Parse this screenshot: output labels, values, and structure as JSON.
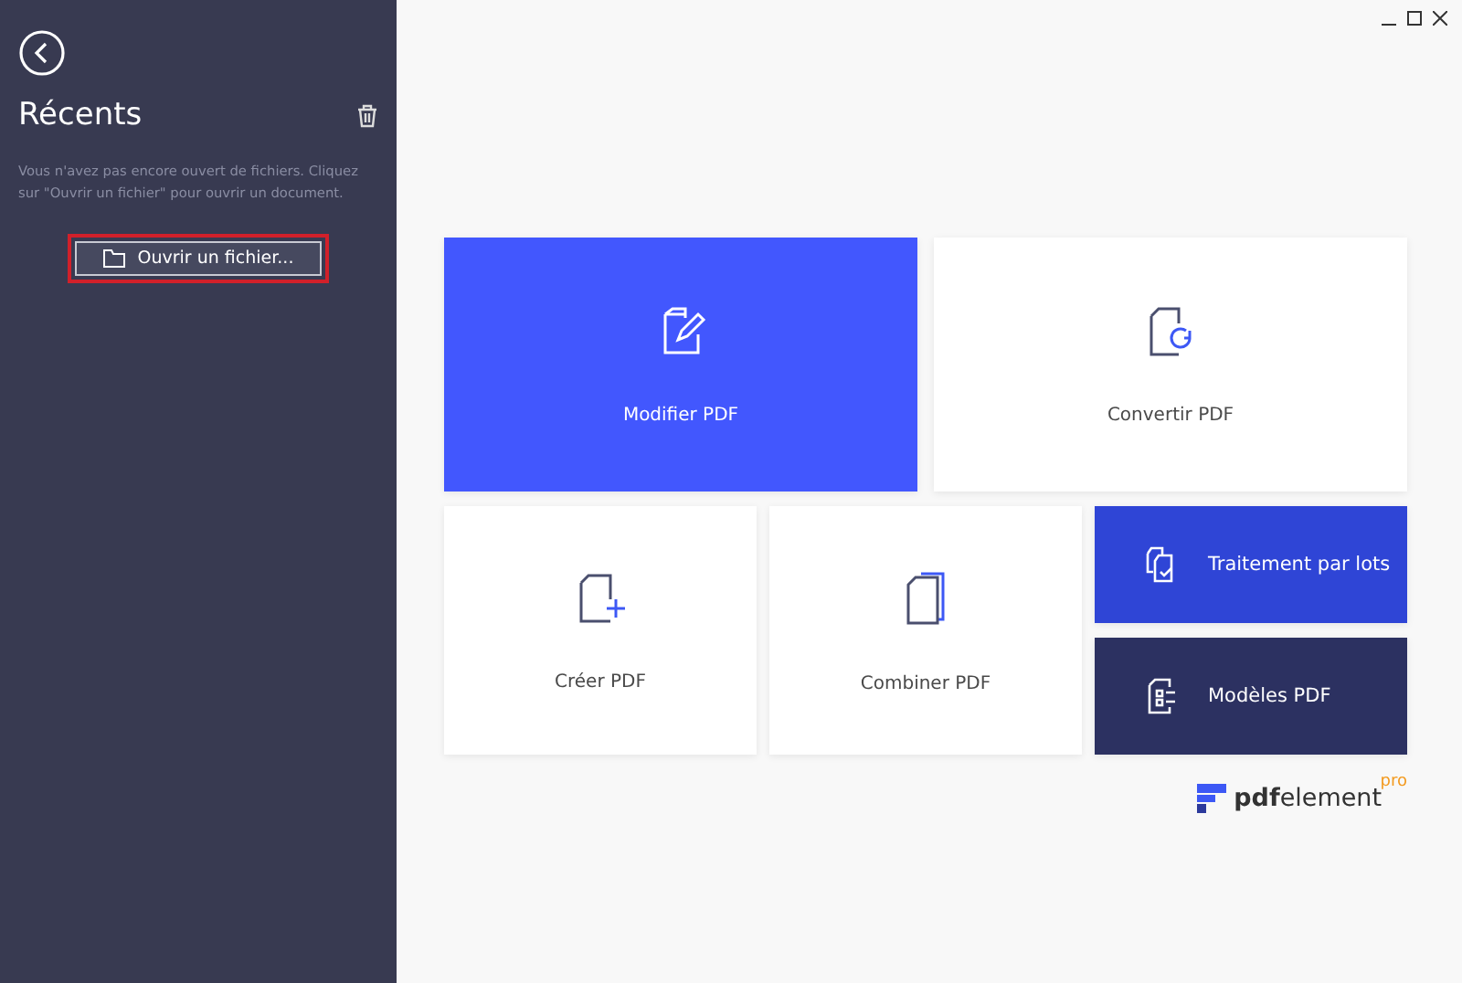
{
  "sidebar": {
    "title": "Récents",
    "message": "Vous n'avez pas encore ouvert de fichiers. Cliquez sur \"Ouvrir un fichier\" pour ouvrir un document.",
    "open_button": {
      "label": "Ouvrir un fichier...",
      "highlighted": true
    }
  },
  "tiles": [
    {
      "label": "Modifier PDF",
      "kind": "edit",
      "color": "#4257fe"
    },
    {
      "label": "Convertir PDF",
      "kind": "convert",
      "color": "#ffffff"
    },
    {
      "label": "Créer PDF",
      "kind": "create",
      "color": "#ffffff"
    },
    {
      "label": "Combiner PDF",
      "kind": "combine",
      "color": "#ffffff"
    },
    {
      "label": "Traitement par lots",
      "kind": "batch",
      "color": "#2f45d6"
    },
    {
      "label": "Modèles PDF",
      "kind": "templates",
      "color": "#2c3161"
    }
  ],
  "logo": {
    "text": "**pdf**element",
    "badge": "pro"
  }
}
